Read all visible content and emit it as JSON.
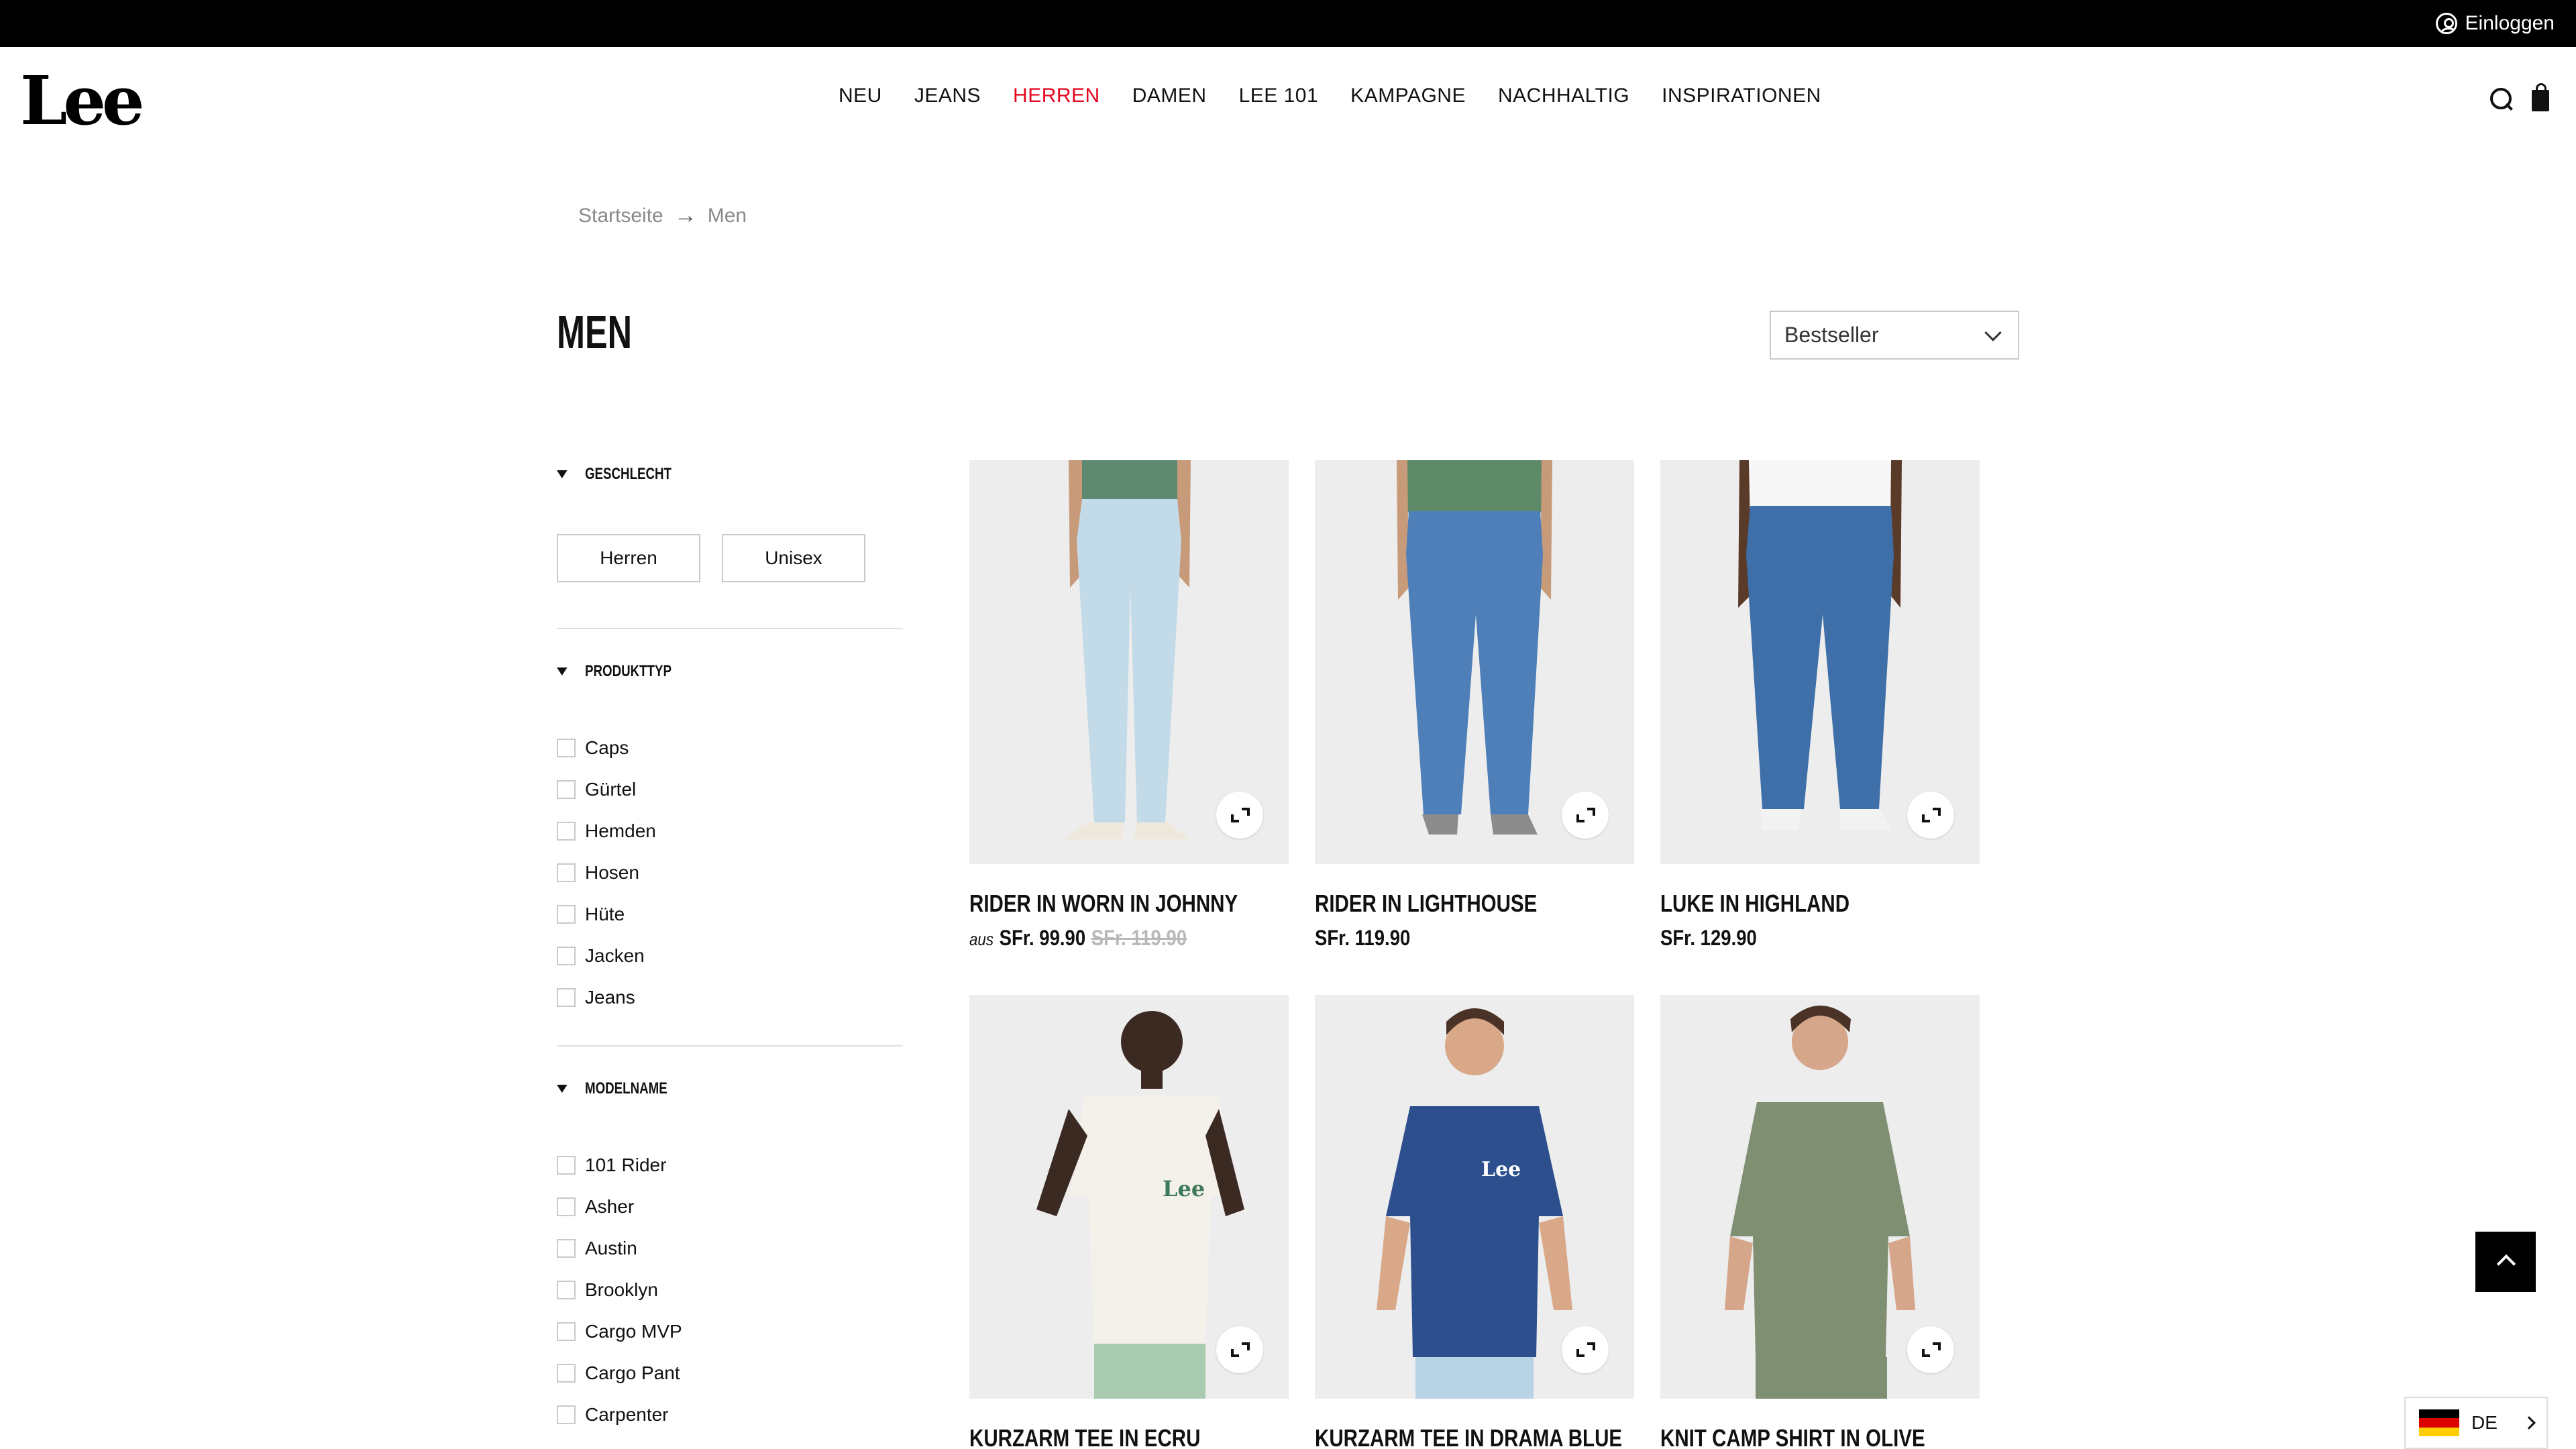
{
  "topbar": {
    "login_label": "Einloggen"
  },
  "header": {
    "logo": "Lee",
    "nav": [
      "NEU",
      "JEANS",
      "HERREN",
      "DAMEN",
      "LEE 101",
      "KAMPAGNE",
      "NACHHALTIG",
      "INSPIRATIONEN"
    ],
    "active_nav": "HERREN",
    "accent_color": "#e4051f",
    "icons": [
      "search-icon",
      "bag-icon"
    ]
  },
  "breadcrumb": {
    "home": "Startseite",
    "current": "Men"
  },
  "page": {
    "title": "MEN"
  },
  "sort": {
    "selected": "Bestseller"
  },
  "filters": {
    "gender": {
      "title": "GESCHLECHT",
      "options": [
        "Herren",
        "Unisex"
      ]
    },
    "product_type": {
      "title": "PRODUKTTYP",
      "options": [
        "Caps",
        "Gürtel",
        "Hemden",
        "Hosen",
        "Hüte",
        "Jacken",
        "Jeans"
      ]
    },
    "model_name": {
      "title": "MODELNAME",
      "options": [
        "101 Rider",
        "Asher",
        "Austin",
        "Brooklyn",
        "Cargo MVP",
        "Cargo Pant",
        "Carpenter"
      ]
    }
  },
  "products": [
    {
      "name": "RIDER IN WORN IN JOHNNY",
      "price_prefix": "aus",
      "price": "SFr. 99.90",
      "old_price": "SFr. 119.90"
    },
    {
      "name": "RIDER IN LIGHTHOUSE",
      "price": "SFr. 119.90"
    },
    {
      "name": "LUKE IN HIGHLAND",
      "price": "SFr. 129.90"
    },
    {
      "name": "KURZARM TEE IN ECRU"
    },
    {
      "name": "KURZARM TEE IN DRAMA BLUE"
    },
    {
      "name": "KNIT CAMP SHIRT IN OLIVE"
    }
  ],
  "product_image_text": {
    "tee_logo": "Lee"
  },
  "language": {
    "code": "DE"
  }
}
